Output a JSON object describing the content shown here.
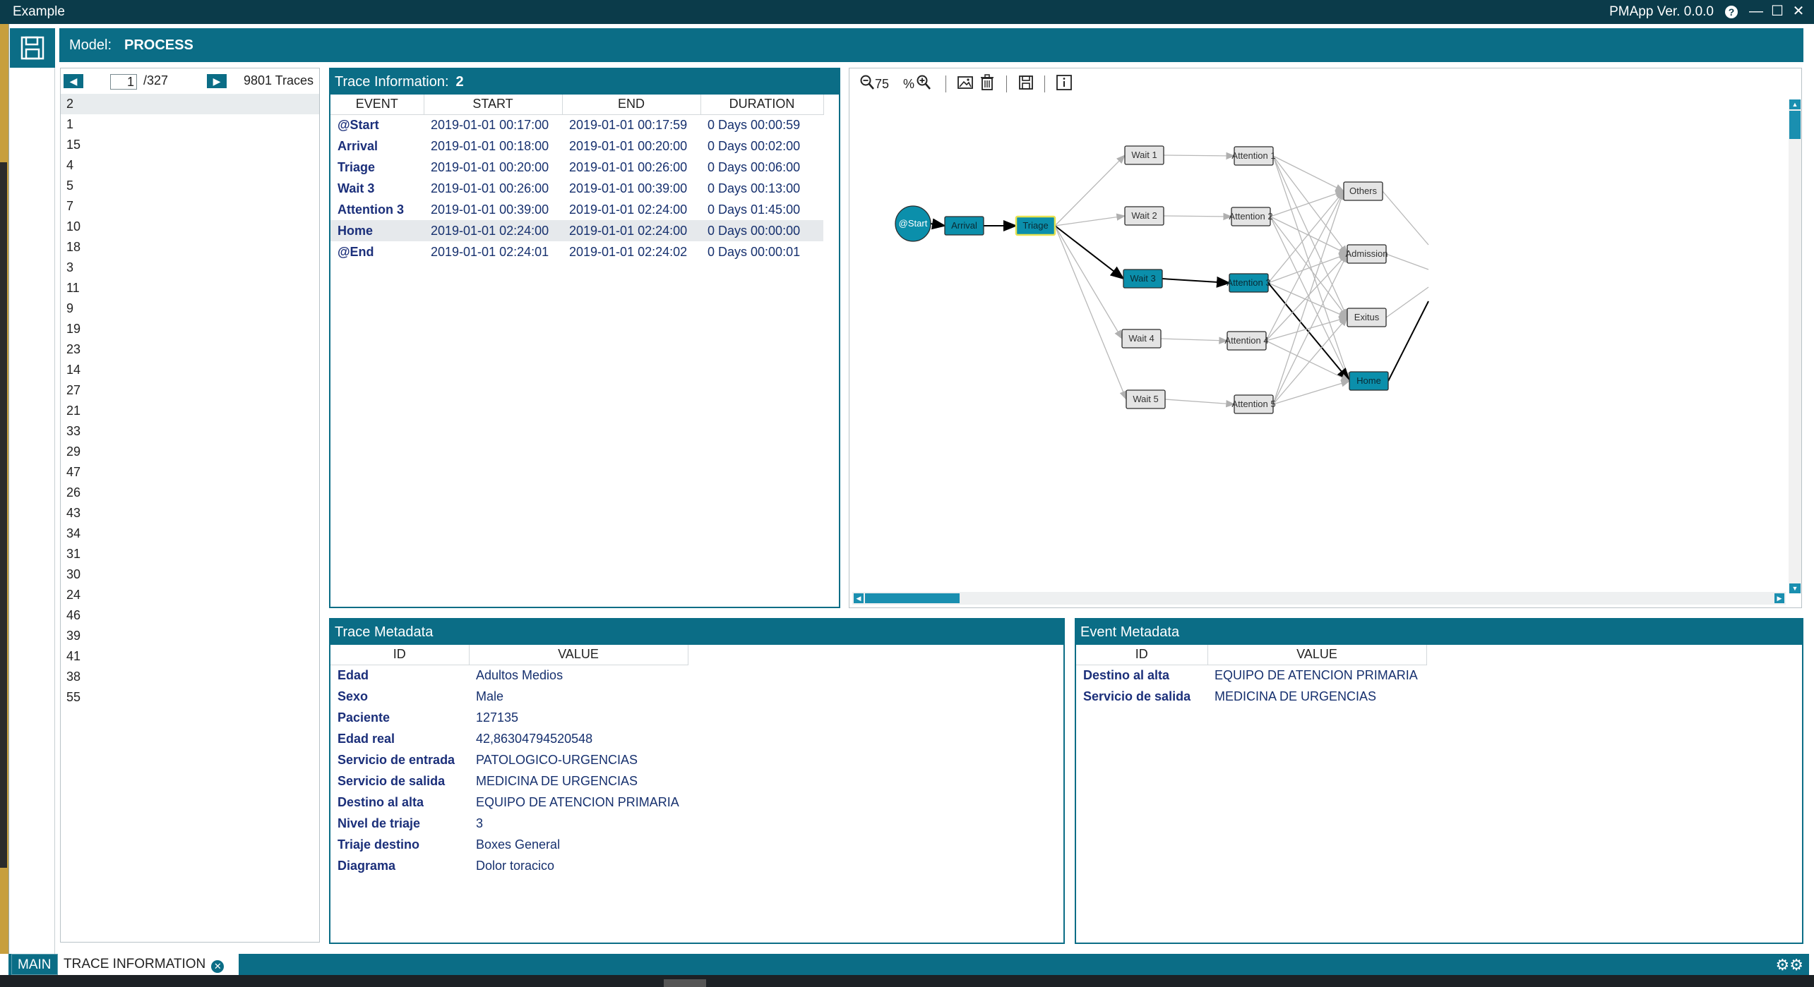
{
  "window": {
    "title": "Example",
    "version": "PMApp Ver. 0.0.0",
    "help_icon": "question-circle-icon"
  },
  "model": {
    "label": "Model:",
    "name": "PROCESS"
  },
  "pager": {
    "current": "1",
    "total": "/327",
    "trace_count": "9801 Traces"
  },
  "trace_ids": [
    "2",
    "1",
    "15",
    "4",
    "5",
    "7",
    "10",
    "18",
    "3",
    "11",
    "9",
    "19",
    "23",
    "14",
    "27",
    "21",
    "33",
    "29",
    "47",
    "26",
    "43",
    "34",
    "31",
    "30",
    "24",
    "46",
    "39",
    "41",
    "38",
    "55"
  ],
  "trace_info": {
    "title": "Trace Information:",
    "trace_id": "2",
    "columns": [
      "EVENT",
      "START",
      "END",
      "DURATION"
    ],
    "rows": [
      {
        "event": "@Start",
        "start": "2019-01-01 00:17:00",
        "end": "2019-01-01 00:17:59",
        "duration": "0 Days 00:00:59"
      },
      {
        "event": "Arrival",
        "start": "2019-01-01 00:18:00",
        "end": "2019-01-01 00:20:00",
        "duration": "0 Days 00:02:00"
      },
      {
        "event": "Triage",
        "start": "2019-01-01 00:20:00",
        "end": "2019-01-01 00:26:00",
        "duration": "0 Days 00:06:00"
      },
      {
        "event": "Wait 3",
        "start": "2019-01-01 00:26:00",
        "end": "2019-01-01 00:39:00",
        "duration": "0 Days 00:13:00"
      },
      {
        "event": "Attention 3",
        "start": "2019-01-01 00:39:00",
        "end": "2019-01-01 02:24:00",
        "duration": "0 Days 01:45:00"
      },
      {
        "event": "Home",
        "start": "2019-01-01 02:24:00",
        "end": "2019-01-01 02:24:00",
        "duration": "0 Days 00:00:00"
      },
      {
        "event": "@End",
        "start": "2019-01-01 02:24:01",
        "end": "2019-01-01 02:24:02",
        "duration": "0 Days 00:00:01"
      }
    ]
  },
  "graph_toolbar": {
    "zoom": "75",
    "zoom_unit": "%"
  },
  "graph": {
    "nodes": [
      "@Start",
      "Arrival",
      "Triage",
      "Wait 1",
      "Wait 2",
      "Wait 3",
      "Wait 4",
      "Wait 5",
      "Attention 1",
      "Attention 2",
      "Attention 3",
      "Attention 4",
      "Attention 5",
      "Others",
      "Admission",
      "Exitus",
      "Home"
    ],
    "highlight_color": "#0b8fab",
    "node_color": "#e4e4e4"
  },
  "trace_metadata": {
    "title": "Trace Metadata",
    "columns": [
      "ID",
      "VALUE"
    ],
    "rows": [
      {
        "id": "Edad",
        "value": "Adultos Medios"
      },
      {
        "id": "Sexo",
        "value": "Male"
      },
      {
        "id": "Paciente",
        "value": "127135"
      },
      {
        "id": "Edad real",
        "value": "42,86304794520548"
      },
      {
        "id": "Servicio de entrada",
        "value": "PATOLOGICO-URGENCIAS"
      },
      {
        "id": "Servicio de salida",
        "value": "MEDICINA DE URGENCIAS"
      },
      {
        "id": "Destino al alta",
        "value": "EQUIPO DE ATENCION PRIMARIA"
      },
      {
        "id": "Nivel de triaje",
        "value": "3"
      },
      {
        "id": "Triaje destino",
        "value": "Boxes General"
      },
      {
        "id": "Diagrama",
        "value": "Dolor toracico"
      }
    ]
  },
  "event_metadata": {
    "title": "Event Metadata",
    "columns": [
      "ID",
      "VALUE"
    ],
    "rows": [
      {
        "id": "Destino al alta",
        "value": "EQUIPO DE ATENCION PRIMARIA"
      },
      {
        "id": "Servicio de salida",
        "value": "MEDICINA DE URGENCIAS"
      }
    ]
  },
  "tabs": {
    "main": "MAIN",
    "trace": "TRACE INFORMATION"
  }
}
